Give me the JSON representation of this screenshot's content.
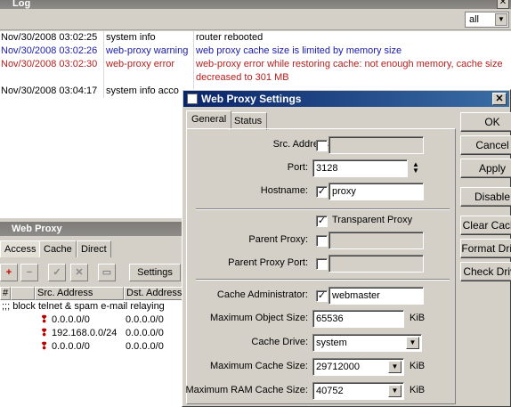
{
  "log": {
    "title": "Log",
    "close": "✕",
    "filter": "all",
    "rows": [
      {
        "time": "Nov/30/2008 03:02:25",
        "topic": "system info",
        "message": "router rebooted",
        "color": "black"
      },
      {
        "time": "Nov/30/2008 03:02:26",
        "topic": "web-proxy warning",
        "message": "web proxy cache size is limited by memory size",
        "color": "blue"
      },
      {
        "time": "Nov/30/2008 03:02:30",
        "topic": "web-proxy error",
        "message": "web-proxy error while restoring cache: not enough memory, cache size",
        "message2": "decreased to 301 MB",
        "color": "red"
      },
      {
        "time": "Nov/30/2008 03:04:17",
        "topic": "system info acco",
        "message": "",
        "color": "black"
      }
    ]
  },
  "webproxy": {
    "title": "Web Proxy",
    "tabs": [
      "Access",
      "Cache",
      "Direct"
    ],
    "toolbar": {
      "add": "+",
      "remove": "−",
      "enable": "✓",
      "disable": "✕",
      "comment": "▭",
      "settings": "Settings"
    },
    "columns": [
      "#",
      "Src. Address",
      "Dst. Address"
    ],
    "comment": ";;; block telnet & spam e-mail relaying",
    "rows": [
      {
        "src": "0.0.0.0/0",
        "dst": "0.0.0.0/0"
      },
      {
        "src": "192.168.0.0/24",
        "dst": "0.0.0.0/0"
      },
      {
        "src": "0.0.0.0/0",
        "dst": "0.0.0.0/0"
      }
    ]
  },
  "dialog": {
    "title": "Web Proxy Settings",
    "close": "✕",
    "tabs": [
      "General",
      "Status"
    ],
    "fields": {
      "src_address": {
        "label": "Src. Address:",
        "value": ""
      },
      "port": {
        "label": "Port:",
        "value": "3128"
      },
      "hostname": {
        "label": "Hostname:",
        "value": "proxy"
      },
      "transparent": {
        "label": "Transparent Proxy"
      },
      "parent_proxy": {
        "label": "Parent Proxy:",
        "value": ""
      },
      "parent_proxy_port": {
        "label": "Parent Proxy Port:",
        "value": ""
      },
      "cache_admin": {
        "label": "Cache Administrator:",
        "value": "webmaster"
      },
      "max_object": {
        "label": "Maximum Object Size:",
        "value": "65536",
        "unit": "KiB"
      },
      "cache_drive": {
        "label": "Cache Drive:",
        "value": "system"
      },
      "max_cache": {
        "label": "Maximum Cache Size:",
        "value": "29712000",
        "unit": "KiB"
      },
      "max_ram": {
        "label": "Maximum RAM Cache Size:",
        "value": "40752",
        "unit": "KiB"
      }
    },
    "checks": {
      "src_address": false,
      "hostname": true,
      "transparent": true,
      "parent_proxy": false,
      "parent_proxy_port": false,
      "cache_admin": true
    },
    "check_mark": "✓",
    "buttons": {
      "ok": "OK",
      "cancel": "Cancel",
      "apply": "Apply",
      "disable": "Disable",
      "clear_cache": "Clear Cache",
      "format_drive": "Format Drive",
      "check_drive": "Check Drive"
    }
  }
}
